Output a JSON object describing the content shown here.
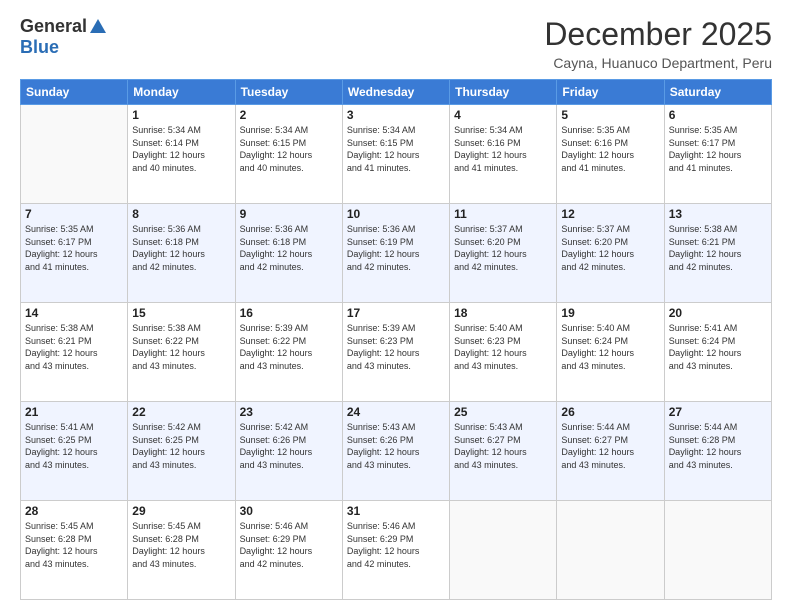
{
  "logo": {
    "general": "General",
    "blue": "Blue"
  },
  "header": {
    "month": "December 2025",
    "location": "Cayna, Huanuco Department, Peru"
  },
  "weekdays": [
    "Sunday",
    "Monday",
    "Tuesday",
    "Wednesday",
    "Thursday",
    "Friday",
    "Saturday"
  ],
  "weeks": [
    [
      {
        "day": "",
        "sunrise": "",
        "sunset": "",
        "daylight": ""
      },
      {
        "day": "1",
        "sunrise": "Sunrise: 5:34 AM",
        "sunset": "Sunset: 6:14 PM",
        "daylight": "Daylight: 12 hours and 40 minutes."
      },
      {
        "day": "2",
        "sunrise": "Sunrise: 5:34 AM",
        "sunset": "Sunset: 6:15 PM",
        "daylight": "Daylight: 12 hours and 40 minutes."
      },
      {
        "day": "3",
        "sunrise": "Sunrise: 5:34 AM",
        "sunset": "Sunset: 6:15 PM",
        "daylight": "Daylight: 12 hours and 41 minutes."
      },
      {
        "day": "4",
        "sunrise": "Sunrise: 5:34 AM",
        "sunset": "Sunset: 6:16 PM",
        "daylight": "Daylight: 12 hours and 41 minutes."
      },
      {
        "day": "5",
        "sunrise": "Sunrise: 5:35 AM",
        "sunset": "Sunset: 6:16 PM",
        "daylight": "Daylight: 12 hours and 41 minutes."
      },
      {
        "day": "6",
        "sunrise": "Sunrise: 5:35 AM",
        "sunset": "Sunset: 6:17 PM",
        "daylight": "Daylight: 12 hours and 41 minutes."
      }
    ],
    [
      {
        "day": "7",
        "sunrise": "Sunrise: 5:35 AM",
        "sunset": "Sunset: 6:17 PM",
        "daylight": "Daylight: 12 hours and 41 minutes."
      },
      {
        "day": "8",
        "sunrise": "Sunrise: 5:36 AM",
        "sunset": "Sunset: 6:18 PM",
        "daylight": "Daylight: 12 hours and 42 minutes."
      },
      {
        "day": "9",
        "sunrise": "Sunrise: 5:36 AM",
        "sunset": "Sunset: 6:18 PM",
        "daylight": "Daylight: 12 hours and 42 minutes."
      },
      {
        "day": "10",
        "sunrise": "Sunrise: 5:36 AM",
        "sunset": "Sunset: 6:19 PM",
        "daylight": "Daylight: 12 hours and 42 minutes."
      },
      {
        "day": "11",
        "sunrise": "Sunrise: 5:37 AM",
        "sunset": "Sunset: 6:20 PM",
        "daylight": "Daylight: 12 hours and 42 minutes."
      },
      {
        "day": "12",
        "sunrise": "Sunrise: 5:37 AM",
        "sunset": "Sunset: 6:20 PM",
        "daylight": "Daylight: 12 hours and 42 minutes."
      },
      {
        "day": "13",
        "sunrise": "Sunrise: 5:38 AM",
        "sunset": "Sunset: 6:21 PM",
        "daylight": "Daylight: 12 hours and 42 minutes."
      }
    ],
    [
      {
        "day": "14",
        "sunrise": "Sunrise: 5:38 AM",
        "sunset": "Sunset: 6:21 PM",
        "daylight": "Daylight: 12 hours and 43 minutes."
      },
      {
        "day": "15",
        "sunrise": "Sunrise: 5:38 AM",
        "sunset": "Sunset: 6:22 PM",
        "daylight": "Daylight: 12 hours and 43 minutes."
      },
      {
        "day": "16",
        "sunrise": "Sunrise: 5:39 AM",
        "sunset": "Sunset: 6:22 PM",
        "daylight": "Daylight: 12 hours and 43 minutes."
      },
      {
        "day": "17",
        "sunrise": "Sunrise: 5:39 AM",
        "sunset": "Sunset: 6:23 PM",
        "daylight": "Daylight: 12 hours and 43 minutes."
      },
      {
        "day": "18",
        "sunrise": "Sunrise: 5:40 AM",
        "sunset": "Sunset: 6:23 PM",
        "daylight": "Daylight: 12 hours and 43 minutes."
      },
      {
        "day": "19",
        "sunrise": "Sunrise: 5:40 AM",
        "sunset": "Sunset: 6:24 PM",
        "daylight": "Daylight: 12 hours and 43 minutes."
      },
      {
        "day": "20",
        "sunrise": "Sunrise: 5:41 AM",
        "sunset": "Sunset: 6:24 PM",
        "daylight": "Daylight: 12 hours and 43 minutes."
      }
    ],
    [
      {
        "day": "21",
        "sunrise": "Sunrise: 5:41 AM",
        "sunset": "Sunset: 6:25 PM",
        "daylight": "Daylight: 12 hours and 43 minutes."
      },
      {
        "day": "22",
        "sunrise": "Sunrise: 5:42 AM",
        "sunset": "Sunset: 6:25 PM",
        "daylight": "Daylight: 12 hours and 43 minutes."
      },
      {
        "day": "23",
        "sunrise": "Sunrise: 5:42 AM",
        "sunset": "Sunset: 6:26 PM",
        "daylight": "Daylight: 12 hours and 43 minutes."
      },
      {
        "day": "24",
        "sunrise": "Sunrise: 5:43 AM",
        "sunset": "Sunset: 6:26 PM",
        "daylight": "Daylight: 12 hours and 43 minutes."
      },
      {
        "day": "25",
        "sunrise": "Sunrise: 5:43 AM",
        "sunset": "Sunset: 6:27 PM",
        "daylight": "Daylight: 12 hours and 43 minutes."
      },
      {
        "day": "26",
        "sunrise": "Sunrise: 5:44 AM",
        "sunset": "Sunset: 6:27 PM",
        "daylight": "Daylight: 12 hours and 43 minutes."
      },
      {
        "day": "27",
        "sunrise": "Sunrise: 5:44 AM",
        "sunset": "Sunset: 6:28 PM",
        "daylight": "Daylight: 12 hours and 43 minutes."
      }
    ],
    [
      {
        "day": "28",
        "sunrise": "Sunrise: 5:45 AM",
        "sunset": "Sunset: 6:28 PM",
        "daylight": "Daylight: 12 hours and 43 minutes."
      },
      {
        "day": "29",
        "sunrise": "Sunrise: 5:45 AM",
        "sunset": "Sunset: 6:28 PM",
        "daylight": "Daylight: 12 hours and 43 minutes."
      },
      {
        "day": "30",
        "sunrise": "Sunrise: 5:46 AM",
        "sunset": "Sunset: 6:29 PM",
        "daylight": "Daylight: 12 hours and 42 minutes."
      },
      {
        "day": "31",
        "sunrise": "Sunrise: 5:46 AM",
        "sunset": "Sunset: 6:29 PM",
        "daylight": "Daylight: 12 hours and 42 minutes."
      },
      {
        "day": "",
        "sunrise": "",
        "sunset": "",
        "daylight": ""
      },
      {
        "day": "",
        "sunrise": "",
        "sunset": "",
        "daylight": ""
      },
      {
        "day": "",
        "sunrise": "",
        "sunset": "",
        "daylight": ""
      }
    ]
  ]
}
